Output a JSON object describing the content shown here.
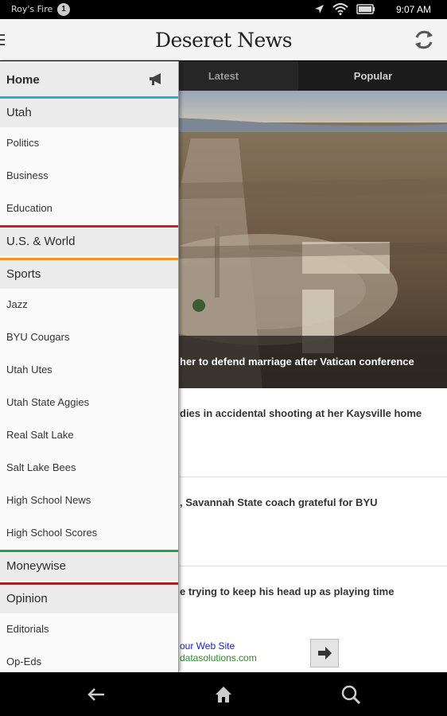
{
  "status_bar": {
    "notification_label": "Roy's Fire",
    "notification_count": "1",
    "time": "9:07 AM",
    "icons": [
      "location-icon",
      "wifi-icon",
      "battery-icon"
    ]
  },
  "app_bar": {
    "logo": "Deseret News",
    "icons": [
      "menu-icon",
      "refresh-icon"
    ]
  },
  "tabs": [
    {
      "label": "Latest"
    },
    {
      "label": "Popular"
    }
  ],
  "hero": {
    "headline": "her to defend marriage after Vatican conference"
  },
  "stories": [
    {
      "headline": "dies in accidental shooting at her Kaysville home"
    },
    {
      "headline": ", Savannah State coach grateful for BYU"
    },
    {
      "headline": "e trying to keep his head up as playing time"
    }
  ],
  "ad": {
    "title": "our Web Site",
    "url": "datasolutions.com",
    "icon": "arrow-right-icon"
  },
  "drawer": {
    "home": {
      "label": "Home",
      "icon": "megaphone-icon"
    },
    "sections": [
      {
        "label": "Utah",
        "color": "#2aa7e0",
        "items": [
          "Politics",
          "Business",
          "Education"
        ]
      },
      {
        "label": "U.S. & World",
        "color": "#c8202a",
        "items": []
      },
      {
        "label": "Sports",
        "color": "#f0961e",
        "items": [
          "Jazz",
          "BYU Cougars",
          "Utah Utes",
          "Utah State Aggies",
          "Real Salt Lake",
          "Salt Lake Bees",
          "High School News",
          "High School Scores"
        ]
      },
      {
        "label": "Moneywise",
        "color": "#21a54a",
        "items": []
      },
      {
        "label": "Opinion",
        "color": "#a51e24",
        "items": [
          "Editorials",
          "Op-Eds"
        ]
      }
    ]
  },
  "nav_bar": {
    "icons": [
      "back-icon",
      "home-icon",
      "search-icon"
    ]
  }
}
